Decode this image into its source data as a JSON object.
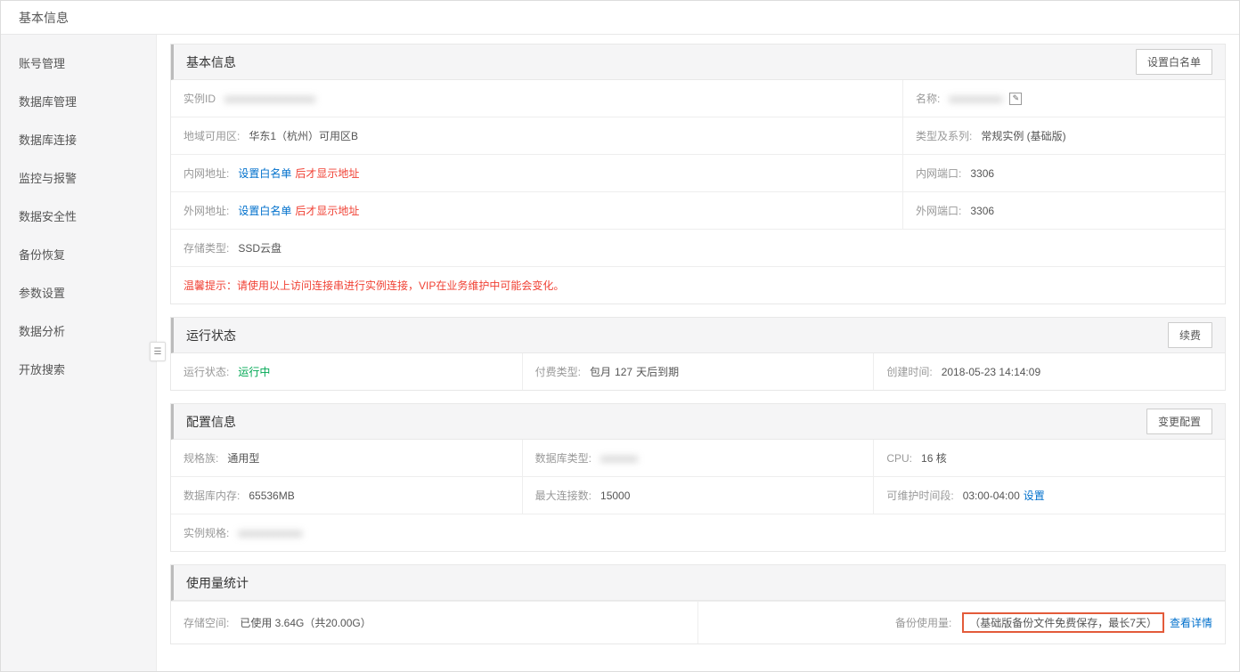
{
  "header": {
    "title": "基本信息"
  },
  "sidebar": {
    "items": [
      "账号管理",
      "数据库管理",
      "数据库连接",
      "监控与报警",
      "数据安全性",
      "备份恢复",
      "参数设置",
      "数据分析",
      "开放搜索"
    ]
  },
  "basic": {
    "title": "基本信息",
    "button": "设置白名单",
    "instance_id_label": "实例ID",
    "instance_id_value": "",
    "name_label": "名称:",
    "name_value": "",
    "region_label": "地域可用区:",
    "region_value": "华东1（杭州）可用区B",
    "type_label": "类型及系列:",
    "type_value": "常规实例 (基础版)",
    "intranet_addr_label": "内网地址:",
    "intranet_addr_link": "设置白名单",
    "intranet_addr_after": "后才显示地址",
    "intranet_port_label": "内网端口:",
    "intranet_port_value": "3306",
    "extranet_addr_label": "外网地址:",
    "extranet_addr_link": "设置白名单",
    "extranet_addr_after": "后才显示地址",
    "extranet_port_label": "外网端口:",
    "extranet_port_value": "3306",
    "storage_label": "存储类型:",
    "storage_value": "SSD云盘",
    "tip": "温馨提示：请使用以上访问连接串进行实例连接，VIP在业务维护中可能会变化。"
  },
  "status": {
    "title": "运行状态",
    "button": "续费",
    "status_label": "运行状态:",
    "status_value": "运行中",
    "billing_label": "付费类型:",
    "billing_value1": "包月",
    "billing_days": "127",
    "billing_after": "天后到期",
    "created_label": "创建时间:",
    "created_value": "2018-05-23 14:14:09"
  },
  "config": {
    "title": "配置信息",
    "button": "变更配置",
    "family_label": "规格族:",
    "family_value": "通用型",
    "db_type_label": "数据库类型:",
    "db_type_value": "",
    "cpu_label": "CPU:",
    "cpu_value": "16 核",
    "mem_label": "数据库内存:",
    "mem_value": "65536MB",
    "maxconn_label": "最大连接数:",
    "maxconn_value": "15000",
    "maint_label": "可维护时间段:",
    "maint_value": "03:00-04:00",
    "maint_link": "设置",
    "spec_label": "实例规格:",
    "spec_value": ""
  },
  "usage": {
    "title": "使用量统计",
    "storage_label": "存储空间:",
    "storage_value": "已使用 3.64G（共20.00G）",
    "backup_label": "备份使用量:",
    "backup_note": "（基础版备份文件免费保存，最长7天）",
    "backup_link": "查看详情"
  }
}
